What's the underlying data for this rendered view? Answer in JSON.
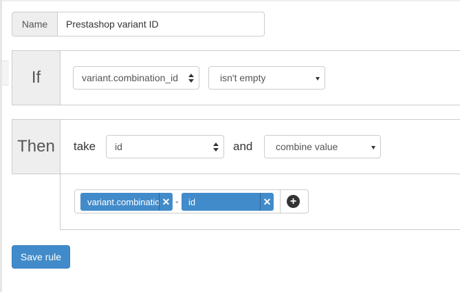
{
  "name_field": {
    "label": "Name",
    "value": "Prestashop variant ID"
  },
  "if_section": {
    "label": "If",
    "field_select": "variant.combination_id",
    "condition_select": "isn't empty"
  },
  "then_section": {
    "label": "Then",
    "take_word": "take",
    "take_select": "id",
    "and_word": "and",
    "action_select": "combine value"
  },
  "combine": {
    "tags": [
      "variant.combination_id",
      "id"
    ],
    "separator": "-",
    "remove_icon": "close-icon",
    "add_icon": "plus-circle-icon"
  },
  "save_button": {
    "label": "Save rule"
  },
  "colors": {
    "primary": "#428bca",
    "addon_bg": "#eeeeee",
    "border": "#cccccc"
  }
}
